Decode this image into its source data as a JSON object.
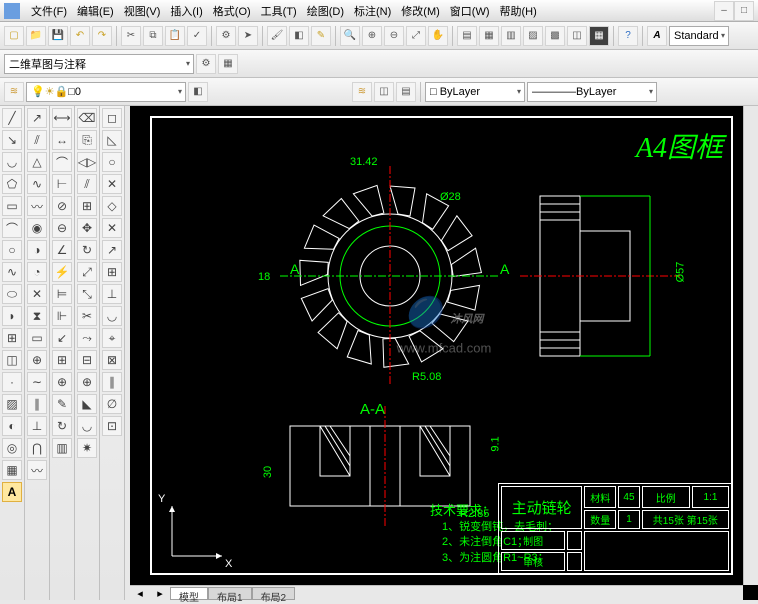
{
  "menu": {
    "items": [
      "文件(F)",
      "编辑(E)",
      "视图(V)",
      "插入(I)",
      "格式(O)",
      "工具(T)",
      "绘图(D)",
      "标注(N)",
      "修改(M)",
      "窗口(W)",
      "帮助(H)"
    ]
  },
  "toolbar2": {
    "viewstyle": "二维草图与注释"
  },
  "toolbar3": {
    "layer0": "□0",
    "layerByLayer1": "□ ByLayer",
    "layerByLayer2": "ByLayer"
  },
  "std_label": "Standard",
  "canvas": {
    "frame_title": "A4图框",
    "dim_3142": "31.42",
    "dim_d28": "Ø28",
    "dim_18": "18",
    "dim_A_left": "A",
    "dim_A_right": "A",
    "dim_r508": "R5.08",
    "dim_d57": "Ø57",
    "section_label": "A-A",
    "dim_30": "30",
    "dim_91": "9.1",
    "dim_r285": "R2.85",
    "coord_x": "X",
    "coord_y": "Y",
    "tech_title": "技术要求：",
    "tech_1": "1、锐变倒钝，去毛刺；",
    "tech_2": "2、未注倒角C1；",
    "tech_3": "3、为注圆角R1~R3；",
    "watermark": "沐风网",
    "watermark_url": "www.mfcad.com"
  },
  "titleblock": {
    "part_name": "主动链轮",
    "mat_label": "材料",
    "mat_val": "45",
    "scale_label": "比例",
    "scale_val": "1:1",
    "qty_label": "数量",
    "qty_val": "1",
    "sheets": "共15张 第15张",
    "drawn_label": "制图",
    "check_label": "审核"
  },
  "tabs": {
    "model": "模型",
    "layout1": "布局1",
    "layout2": "布局2"
  }
}
